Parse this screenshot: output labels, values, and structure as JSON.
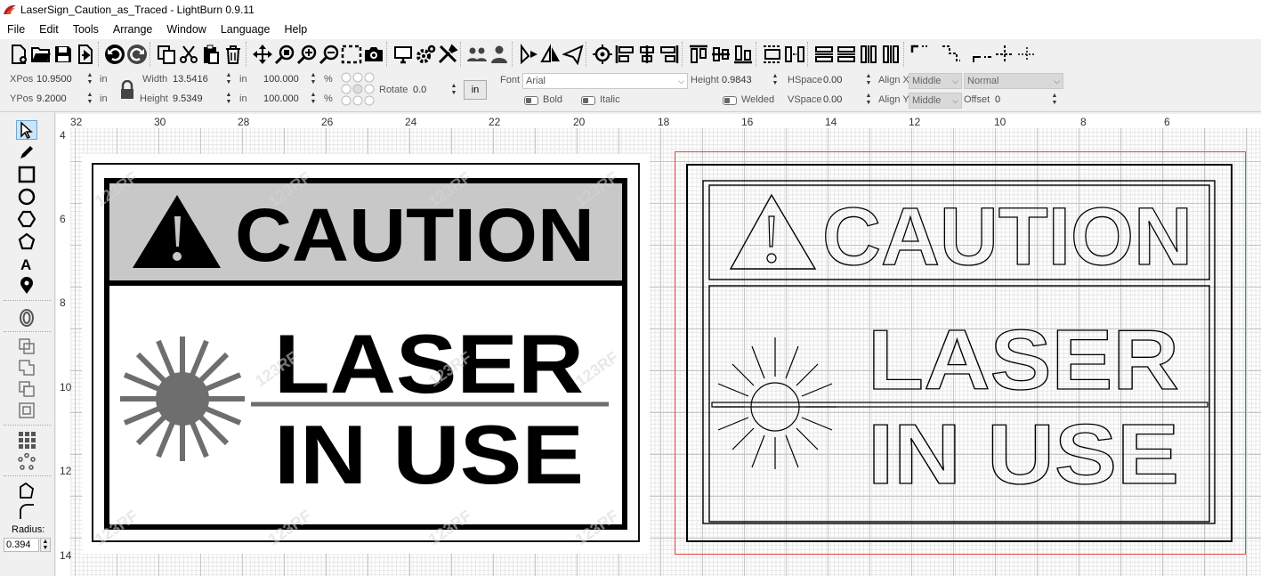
{
  "window": {
    "title": "LaserSign_Caution_as_Traced - LightBurn 0.9.11"
  },
  "menu": [
    "File",
    "Edit",
    "Tools",
    "Arrange",
    "Window",
    "Language",
    "Help"
  ],
  "toolbar_icons": [
    "new-file-icon",
    "open-folder-icon",
    "save-icon",
    "import-icon",
    "undo-icon",
    "redo-icon",
    "copy-icon",
    "cut-icon",
    "paste-icon",
    "delete-icon",
    "move-icon",
    "zoom-fit-icon",
    "zoom-in-icon",
    "zoom-out-icon",
    "frame-selection-icon",
    "camera-icon",
    "monitor-icon",
    "settings-icon",
    "tools-icon",
    "group-icon",
    "ungroup-icon",
    "mirror-h-icon",
    "mirror-v-icon",
    "send-icon",
    "align-center-icon",
    "align-left-icon",
    "align-hcenter-icon",
    "align-right-icon",
    "align-top-icon",
    "align-vcenter-icon",
    "align-bottom-icon",
    "distribute-h-icon",
    "distribute-hspace-icon",
    "move-together-h-icon",
    "move-together-v-icon",
    "dock-left-icon",
    "dock-right-icon",
    "corner-tl-icon",
    "corner-br-icon",
    "center-cross-icon"
  ],
  "props": {
    "xpos_label": "XPos",
    "xpos": "10.9500",
    "ypos_label": "YPos",
    "ypos": "9.2000",
    "unit": "in",
    "width_label": "Width",
    "width": "13.5416",
    "height_label": "Height",
    "height": "9.5349",
    "scale_x": "100.000",
    "scale_y": "100.000",
    "pct": "%",
    "rotate_label": "Rotate",
    "rotate": "0.0",
    "in_button": "in",
    "font_label": "Font",
    "font": "Arial",
    "text_height_label": "Height",
    "text_height": "0.9843",
    "hspace_label": "HSpace",
    "hspace": "0.00",
    "vspace_label": "VSpace",
    "vspace": "0.00",
    "alignx_label": "Align X",
    "alignx": "Middle",
    "aligny_label": "Align Y",
    "aligny": "Middle",
    "mode": "Normal",
    "offset_label": "Offset",
    "offset": "0",
    "bold_label": "Bold",
    "italic_label": "Italic",
    "welded_label": "Welded"
  },
  "left_tools": {
    "radius_label": "Radius:",
    "radius": "0.394"
  },
  "ruler": {
    "top": [
      "32",
      "30",
      "28",
      "26",
      "24",
      "22",
      "20",
      "18",
      "16",
      "14",
      "12",
      "10",
      "8",
      "6"
    ],
    "left": [
      "4",
      "6",
      "8",
      "10",
      "12",
      "14"
    ]
  },
  "sign": {
    "caution": "CAUTION",
    "line1": "LASER",
    "line2": "IN USE",
    "watermark": "123RF"
  },
  "colors": {
    "selection_outline": "#e84a4a",
    "caution_band": "#c8c8c8",
    "burst": "#6e6e6e"
  }
}
